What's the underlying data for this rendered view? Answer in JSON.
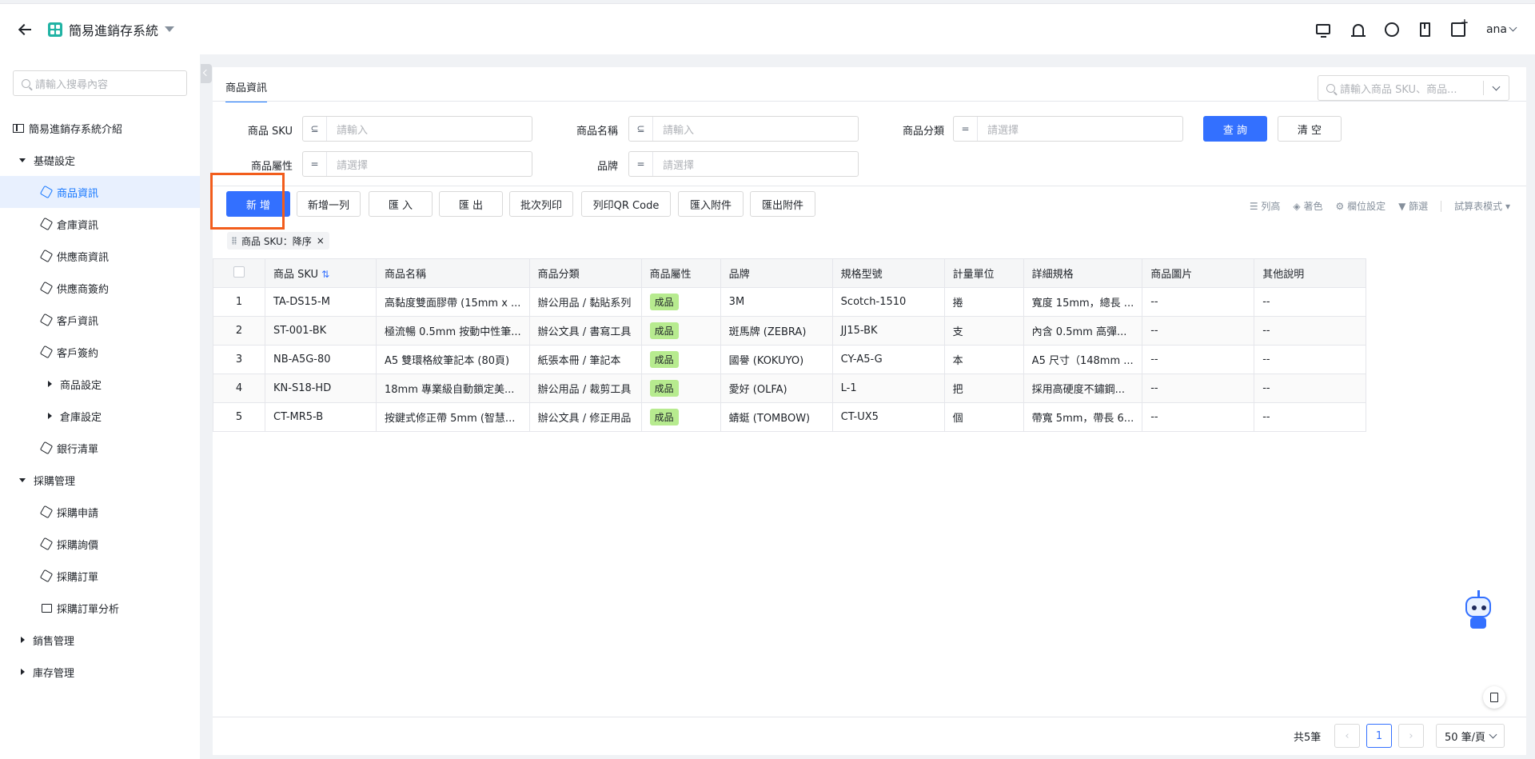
{
  "header": {
    "title": "簡易進銷存系統",
    "user": "ana"
  },
  "sidebar": {
    "search_placeholder": "請輸入搜尋內容",
    "items": [
      {
        "label": "簡易進銷存系統介紹"
      },
      {
        "label": "基礎設定"
      },
      {
        "label": "商品資訊"
      },
      {
        "label": "倉庫資訊"
      },
      {
        "label": "供應商資訊"
      },
      {
        "label": "供應商簽約"
      },
      {
        "label": "客戶資訊"
      },
      {
        "label": "客戶簽約"
      },
      {
        "label": "商品設定"
      },
      {
        "label": "倉庫設定"
      },
      {
        "label": "銀行清單"
      },
      {
        "label": "採購管理"
      },
      {
        "label": "採購申請"
      },
      {
        "label": "採購詢價"
      },
      {
        "label": "採購訂單"
      },
      {
        "label": "採購訂單分析"
      },
      {
        "label": "銷售管理"
      },
      {
        "label": "庫存管理"
      }
    ]
  },
  "main": {
    "tab": "商品資訊",
    "global_search_placeholder": "請輸入商品 SKU、商品...",
    "filters": {
      "sku_label": "商品 SKU",
      "sku_placeholder": "請輸入",
      "name_label": "商品名稱",
      "name_placeholder": "請輸入",
      "category_label": "商品分類",
      "category_placeholder": "請選擇",
      "attr_label": "商品屬性",
      "attr_placeholder": "請選擇",
      "brand_label": "品牌",
      "brand_placeholder": "請選擇",
      "eq_op": "=",
      "query_button": "查 詢",
      "clear_button": "清 空"
    },
    "toolbar": {
      "add": "新 增",
      "add_row": "新增一列",
      "import": "匯 入",
      "export": "匯 出",
      "batch_print": "批次列印",
      "print_qr": "列印QR Code",
      "import_attach": "匯入附件",
      "export_attach": "匯出附件",
      "row_height": "列高",
      "color": "著色",
      "field_settings": "欄位設定",
      "filter": "篩選",
      "spreadsheet_mode": "試算表模式"
    },
    "sort_chip": "商品 SKU：降序",
    "table": {
      "headers": [
        "商品 SKU",
        "商品名稱",
        "商品分類",
        "商品屬性",
        "品牌",
        "規格型號",
        "計量單位",
        "詳細規格",
        "商品圖片",
        "其他說明"
      ],
      "rows": [
        {
          "idx": "1",
          "sku": "TA-DS15-M",
          "name": "高黏度雙面膠帶 (15mm x ...",
          "category": "辦公用品 / 黏貼系列",
          "attr": "成品",
          "brand": "3M",
          "model": "Scotch-1510",
          "unit": "捲",
          "spec": "寬度 15mm，總長 ...",
          "image": "--",
          "note": "--"
        },
        {
          "idx": "2",
          "sku": "ST-001-BK",
          "name": "極流暢 0.5mm 按動中性筆...",
          "category": "辦公文具 / 書寫工具",
          "attr": "成品",
          "brand": "斑馬牌 (ZEBRA)",
          "model": "JJ15-BK",
          "unit": "支",
          "spec": "內含 0.5mm 高彈...",
          "image": "--",
          "note": "--"
        },
        {
          "idx": "3",
          "sku": "NB-A5G-80",
          "name": "A5 雙環格紋筆記本 (80頁)",
          "category": "紙張本冊 / 筆記本",
          "attr": "成品",
          "brand": "國譽 (KOKUYO)",
          "model": "CY-A5-G",
          "unit": "本",
          "spec": "A5 尺寸（148mm ...",
          "image": "--",
          "note": "--"
        },
        {
          "idx": "4",
          "sku": "KN-S18-HD",
          "name": "18mm 專業級自動鎖定美...",
          "category": "辦公用品 / 裁剪工具",
          "attr": "成品",
          "brand": "愛好 (OLFA)",
          "model": "L-1",
          "unit": "把",
          "spec": "採用高硬度不鏽鋼...",
          "image": "--",
          "note": "--"
        },
        {
          "idx": "5",
          "sku": "CT-MR5-B",
          "name": "按鍵式修正帶 5mm (智慧...",
          "category": "辦公文具 / 修正用品",
          "attr": "成品",
          "brand": "蜻蜓 (TOMBOW)",
          "model": "CT-UX5",
          "unit": "個",
          "spec": "帶寬 5mm，帶長 6...",
          "image": "--",
          "note": "--"
        }
      ]
    },
    "pager": {
      "total": "共5筆",
      "current_page": "1",
      "page_size": "50 筆/頁"
    }
  },
  "colors": {
    "primary": "#3370ff",
    "highlight": "#f25d1c",
    "tag_green": "#b7eb8f"
  }
}
